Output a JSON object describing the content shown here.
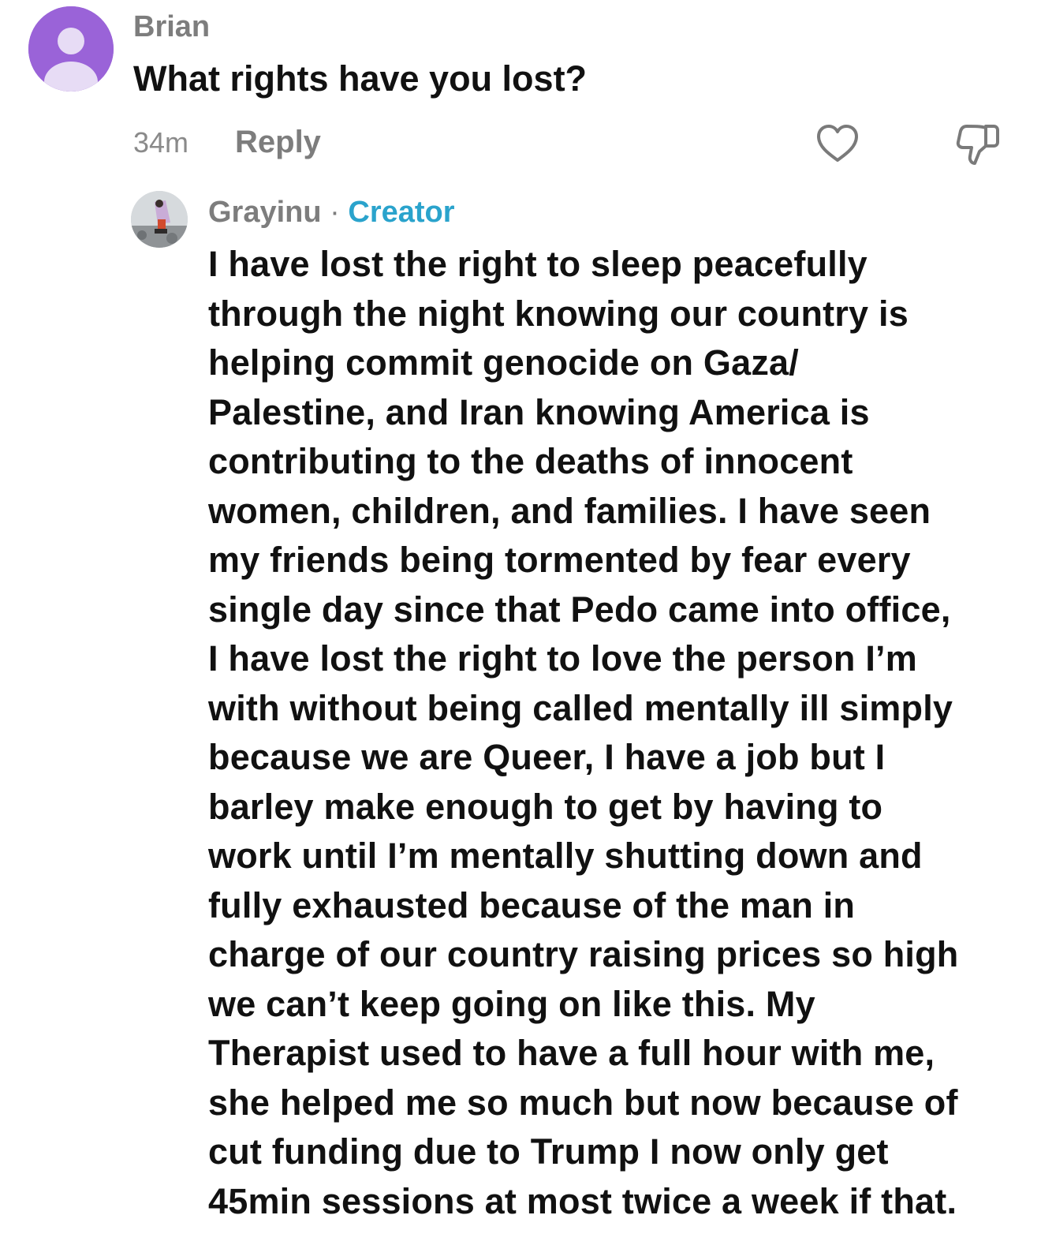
{
  "parent_comment": {
    "username": "Brian",
    "text": "What rights have you lost?",
    "time": "34m",
    "reply_label": "Reply",
    "avatar_color": "#9a63d8"
  },
  "reply_comment": {
    "username": "Grayinu",
    "separator": "·",
    "badge": "Creator",
    "badge_color": "#2aa3cc",
    "lines": [
      "I have lost the right to sleep peacefully",
      "through the night knowing our country is",
      "helping commit genocide on Gaza/",
      "Palestine, and Iran knowing America is",
      "contributing to the deaths of innocent",
      "women, children, and families. I have seen",
      "my friends being tormented by fear every",
      "single day since that Pedo came into office,",
      "I have lost the right to love the person I’m",
      "with without being called mentally ill simply",
      "because we are Queer, I have a job but I",
      "barley make enough to get by having to",
      "work until I’m mentally shutting down and",
      "fully exhausted because of the man in",
      "charge of our country raising prices so high",
      "we can’t keep going on like this. My",
      "Therapist used to have a full hour with me,",
      "she helped me so much but now because of",
      "cut funding due to Trump I now only get",
      "45min sessions at most twice a week if that."
    ]
  },
  "icons": {
    "like": "heart-outline-icon",
    "dislike": "thumbs-down-outline-icon",
    "default_avatar": "person-silhouette-icon"
  }
}
